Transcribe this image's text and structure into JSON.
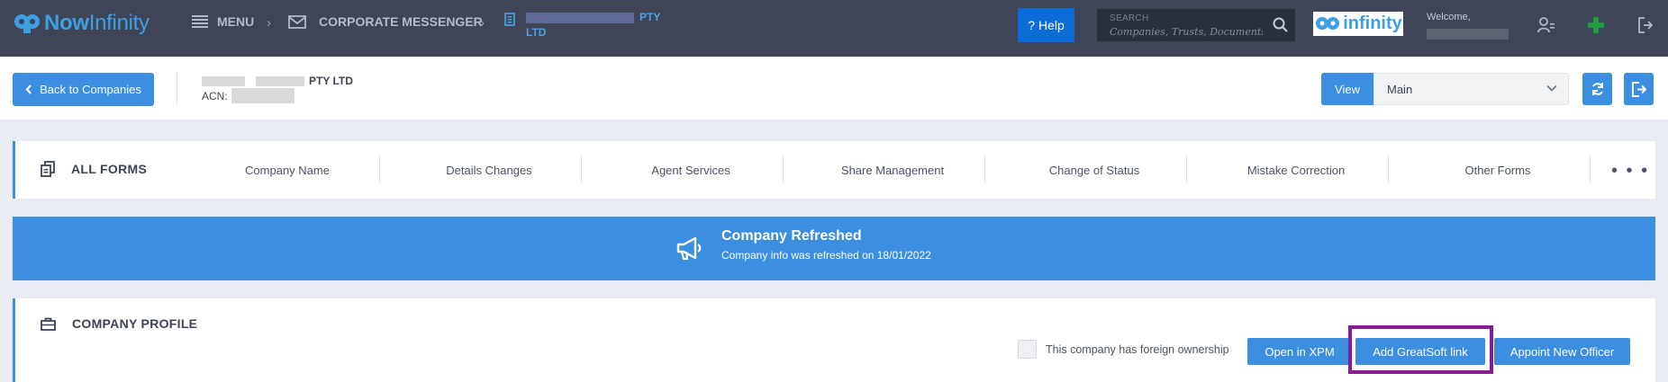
{
  "topbar": {
    "logo": {
      "bold": "Now",
      "rest": "Infinity"
    },
    "menu_label": "MENU",
    "messenger_label": "CORPORATE MESSENGER",
    "company_name_suffix": "PTY",
    "company_name_line2": "LTD",
    "help_label": "? Help",
    "search": {
      "label": "SEARCH",
      "placeholder": "Companies, Trusts, Documents"
    },
    "brand_badge": "infinity",
    "welcome": "Welcome,"
  },
  "header": {
    "back_label": "Back to Companies",
    "company_suffix": "PTY LTD",
    "acn_label": "ACN:",
    "view_label": "View",
    "view_value": "Main"
  },
  "forms": {
    "title": "ALL FORMS",
    "tabs": [
      {
        "label": "Company Name"
      },
      {
        "label": "Details Changes"
      },
      {
        "label": "Agent Services"
      },
      {
        "label": "Share Management"
      },
      {
        "label": "Change of Status"
      },
      {
        "label": "Mistake Correction"
      },
      {
        "label": "Other Forms"
      }
    ],
    "more": "• • •"
  },
  "banner": {
    "title": "Company Refreshed",
    "text": "Company info was refreshed on 18/01/2022"
  },
  "profile": {
    "title": "COMPANY PROFILE",
    "foreign_label": "This company has foreign ownership",
    "buttons": {
      "xpm": "Open in XPM",
      "greatsoft": "Add GreatSoft link",
      "officer": "Appoint New Officer"
    }
  },
  "colors": {
    "topbar": "#3f4456",
    "accent": "#3b8ee0",
    "help": "#0b6cd8",
    "highlight": "#8b1a9a",
    "logo": "#3ea0e4"
  }
}
